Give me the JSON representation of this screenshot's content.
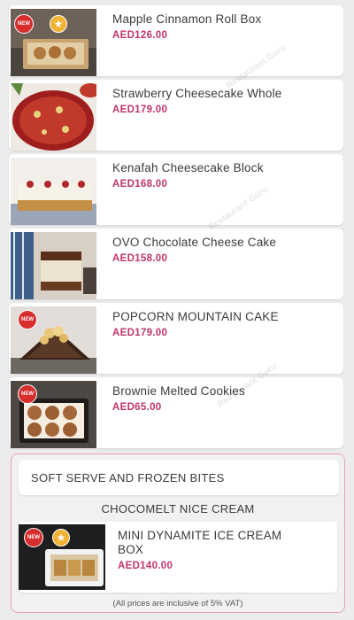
{
  "products": [
    {
      "name": "Mapple Cinnamon Roll Box",
      "price": "AED126.00"
    },
    {
      "name": "Strawberry Cheesecake Whole",
      "price": "AED179.00"
    },
    {
      "name": "Kenafah Cheesecake Block",
      "price": "AED168.00"
    },
    {
      "name": "OVO Chocolate Cheese Cake",
      "price": "AED158.00"
    },
    {
      "name": "POPCORN MOUNTAIN CAKE",
      "price": "AED179.00"
    },
    {
      "name": "Brownie Melted Cookies",
      "price": "AED65.00"
    }
  ],
  "badges": {
    "new_label": "NEW"
  },
  "section": {
    "title": "SOFT SERVE AND FROZEN BITES",
    "subcategory": "CHOCOMELT NICE CREAM",
    "item": {
      "name": "MINI DYNAMITE ICE CREAM BOX",
      "price": "AED140.00"
    },
    "vat_note": "(All prices are inclusive of 5% VAT)"
  },
  "watermark": "Restaurant Guru",
  "colors": {
    "price": "#c0346b",
    "section_border": "#e7a3b4",
    "new_badge": "#d72d2d",
    "star_badge": "#f2b233"
  }
}
